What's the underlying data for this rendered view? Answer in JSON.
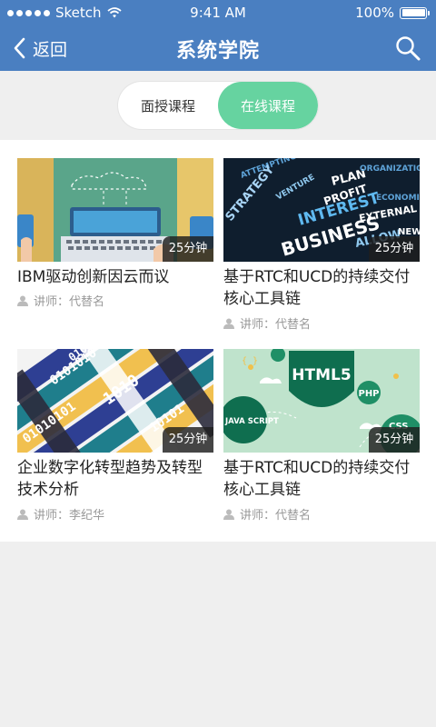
{
  "status_bar": {
    "carrier": "Sketch",
    "time": "9:41 AM",
    "battery": "100%"
  },
  "nav": {
    "back_label": "返回",
    "title": "系统学院"
  },
  "tabs": [
    {
      "label": "面授课程",
      "active": false
    },
    {
      "label": "在线课程",
      "active": true
    }
  ],
  "courses": [
    {
      "title": "IBM驱动创新因云而议",
      "lecturer": "讲师：代替名",
      "duration": "25分钟",
      "thumb": "laptop-illustration"
    },
    {
      "title": "基于RTC和UCD的持续交付核心工具链",
      "lecturer": "讲师：代替名",
      "duration": "25分钟",
      "thumb": "business-word-cloud"
    },
    {
      "title": "企业数字化转型趋势及转型技术分析",
      "lecturer": "讲师：李纪华",
      "duration": "25分钟",
      "thumb": "binary-blocks"
    },
    {
      "title": "基于RTC和UCD的持续交付核心工具链",
      "lecturer": "讲师：代替名",
      "duration": "25分钟",
      "thumb": "html5-illustration"
    }
  ],
  "thumb_text": {
    "business": [
      "ATTEMPTING",
      "PLAN",
      "STRATEGY",
      "PROFIT",
      "INTEREST",
      "EXTERNAL",
      "BUSINESS",
      "ALLOW",
      "ECONOMIC",
      "ORGANIZATION",
      "NEW",
      "VENTURE"
    ],
    "binary": [
      "0101010",
      "1010",
      "01010101",
      "10101",
      "0101"
    ],
    "web": [
      "HTML5",
      "JAVA SCRIPT",
      "PHP",
      "CSS",
      "{ }"
    ]
  },
  "colors": {
    "brand_blue": "#4a7fc1",
    "tab_green": "#66d3a0",
    "background": "#efefef"
  }
}
